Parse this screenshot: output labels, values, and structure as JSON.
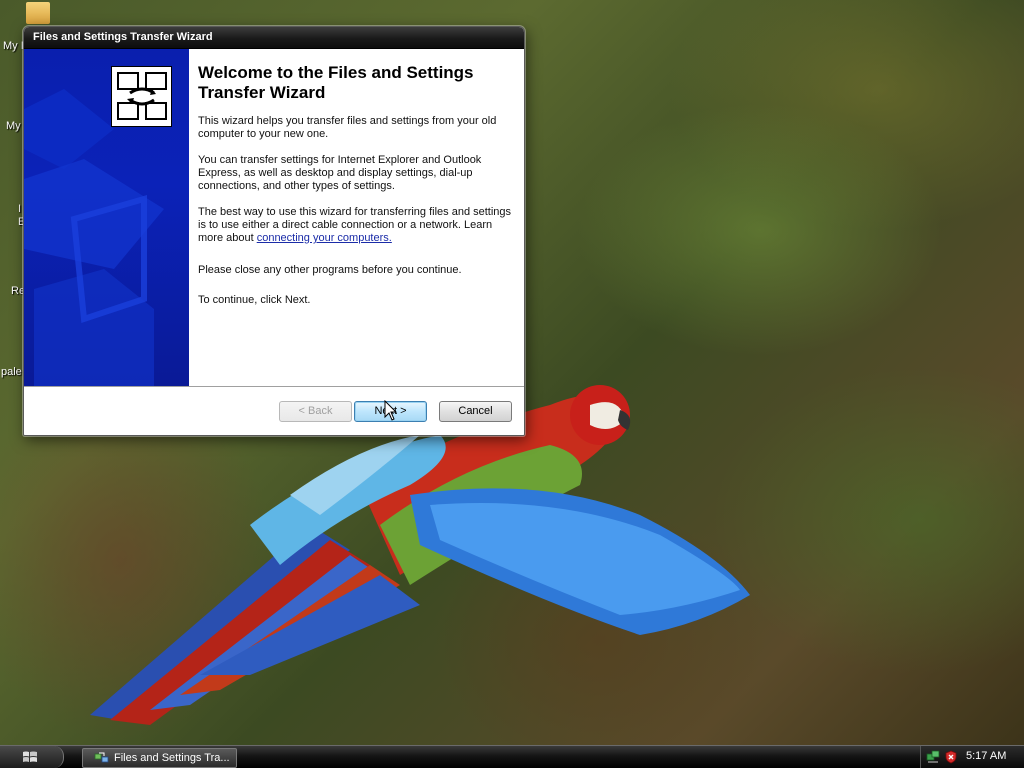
{
  "desktop": {
    "icons": [
      {
        "label": "My I"
      },
      {
        "label": "My"
      },
      {
        "label": "I"
      },
      {
        "label": "E"
      },
      {
        "label": "Re"
      },
      {
        "label": "pale"
      }
    ]
  },
  "window": {
    "title": "Files and Settings Transfer Wizard",
    "heading": "Welcome to the Files and Settings Transfer Wizard",
    "paragraphs": {
      "p1": "This wizard helps you transfer files and settings from your old computer to your new one.",
      "p2": "You can transfer settings for Internet Explorer and Outlook Express, as well as desktop and display settings, dial-up connections, and other types of settings.",
      "p3_prefix": "The best way to use this wizard for transferring files and settings is to use either a direct cable connection or a network. Learn more about ",
      "p3_link": "connecting your computers.",
      "p4": "Please close any other programs before you continue.",
      "p5": "To continue, click Next."
    },
    "buttons": {
      "back": "< Back",
      "next": "Next >",
      "cancel": "Cancel"
    },
    "side_panel_color": "#0b22b8"
  },
  "taskbar": {
    "task_label": "Files and Settings Tra...",
    "clock": "5:17 AM"
  }
}
